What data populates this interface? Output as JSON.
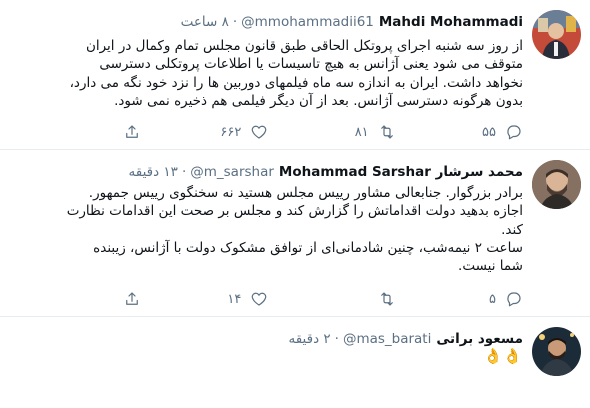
{
  "tweets": [
    {
      "name": "Mahdi Mohammadi",
      "handle": "@mmohammadii61",
      "separator": "·",
      "time": "۸ ساعت",
      "text_lines": [
        "از روز سه شنبه اجرای پروتکل الحاقی طبق قانون مجلس تمام وکمال در ایران",
        "متوقف می شود یعنی آژانس به هیچ تاسیسات یا اطلاعات پروتکلی دسترسی",
        "نخواهد داشت. ایران به اندازه سه ماه فیلمهای دوربین ها را نزد خود نگه می دارد،",
        "بدون هرگونه دسترسی آژانس. بعد از آن دیگر فیلمی هم ذخیره نمی شود."
      ],
      "replies": "۵۵",
      "retweets": "۸۱",
      "likes": "۶۶۲"
    },
    {
      "name": "Mohammad Sarshar محمد سرشار",
      "handle": "@m_sarshar",
      "separator": "·",
      "time": "۱۳ دقیقه",
      "text_lines": [
        "برادر بزرگوار. جنابعالی مشاور رییس مجلس هستید نه سخنگوی رییس جمهور.",
        "اجازه بدهید دولت اقداماتش را گزارش کند و مجلس بر صحت این اقدامات نظارت",
        "کند.",
        "ساعت ۲ نیمه‌شب، چنین شادمانی‌ای از توافق مشکوک دولت با آژانس، زیبنده",
        "شما نیست."
      ],
      "replies": "۵",
      "retweets": "",
      "likes": "۱۴"
    },
    {
      "name": "مسعود براتی",
      "handle": "@mas_barati",
      "separator": "·",
      "time": "۲ دقیقه",
      "emoji_text": "👌👌"
    }
  ],
  "icons": {
    "reply": "reply-icon",
    "retweet": "retweet-icon",
    "like": "heart-icon",
    "share": "share-icon"
  },
  "colors": {
    "text": "#0f1419",
    "secondary": "#5b7083",
    "divider": "#e6ecf0"
  }
}
